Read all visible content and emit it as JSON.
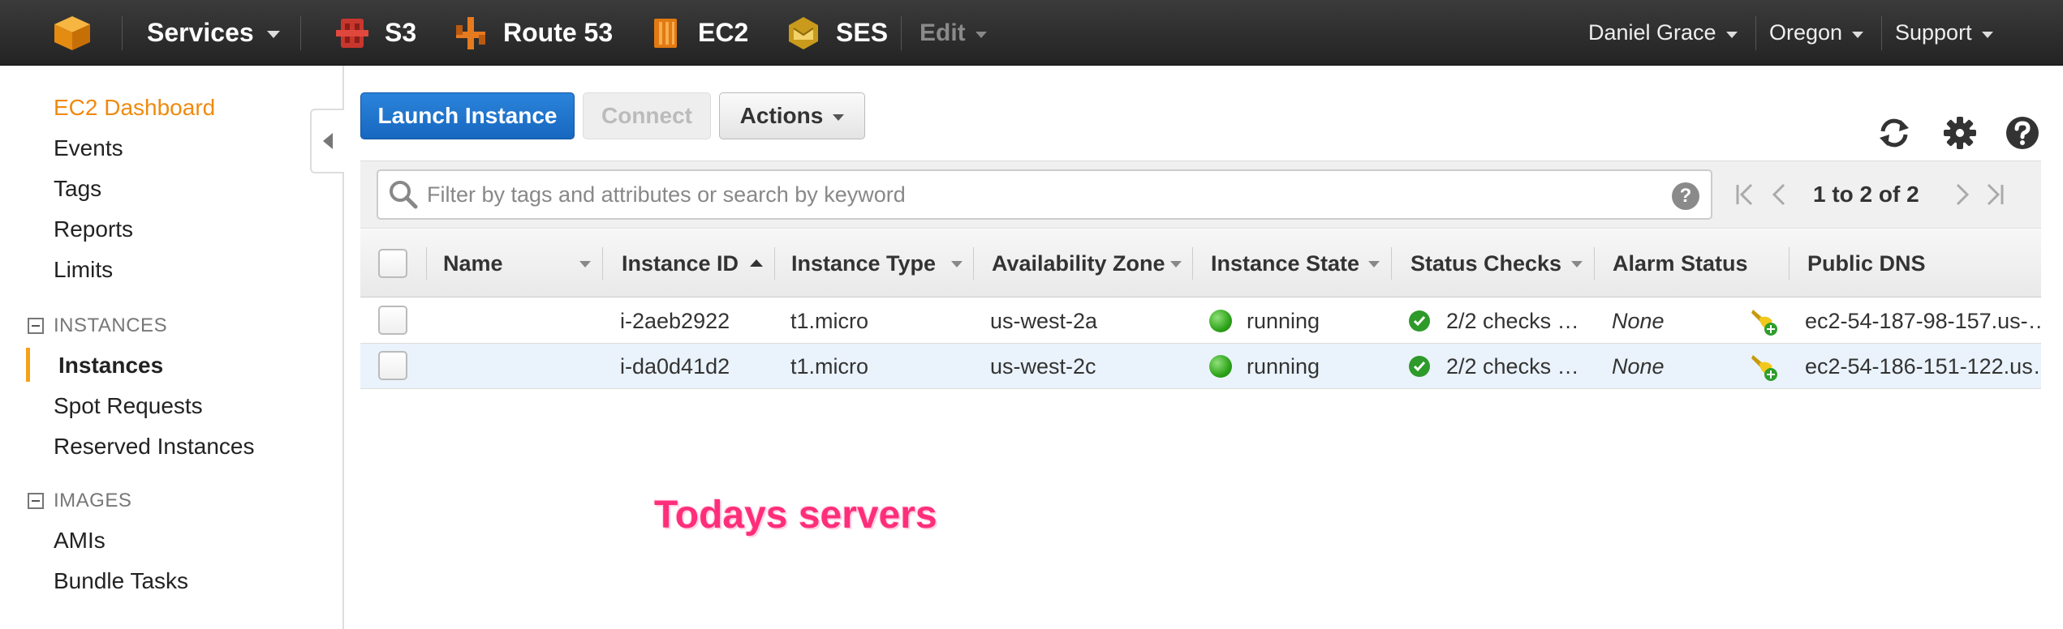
{
  "topnav": {
    "services_label": "Services",
    "shortcuts": [
      {
        "label": "S3",
        "icon": "s3-icon"
      },
      {
        "label": "Route 53",
        "icon": "route53-icon"
      },
      {
        "label": "EC2",
        "icon": "ec2-icon"
      },
      {
        "label": "SES",
        "icon": "ses-icon"
      }
    ],
    "edit_label": "Edit",
    "user_label": "Daniel Grace",
    "region_label": "Oregon",
    "support_label": "Support",
    "brand_color": "#f7a11a"
  },
  "sidebar": {
    "dashboard": "EC2 Dashboard",
    "top_links": [
      "Events",
      "Tags",
      "Reports",
      "Limits"
    ],
    "instances_section": "INSTANCES",
    "instances_links": [
      "Instances",
      "Spot Requests",
      "Reserved Instances"
    ],
    "images_section": "IMAGES",
    "images_links": [
      "AMIs",
      "Bundle Tasks"
    ]
  },
  "toolbar": {
    "launch_label": "Launch Instance",
    "connect_label": "Connect",
    "actions_label": "Actions"
  },
  "filter": {
    "placeholder": "Filter by tags and attributes or search by keyword",
    "help": "?",
    "pagination": "1 to 2 of 2"
  },
  "table": {
    "columns": [
      "Name",
      "Instance ID",
      "Instance Type",
      "Availability Zone",
      "Instance State",
      "Status Checks",
      "Alarm Status",
      "Public DNS"
    ],
    "rows": [
      {
        "name": "",
        "instance_id": "i-2aeb2922",
        "instance_type": "t1.micro",
        "zone": "us-west-2a",
        "state": "running",
        "status_checks": "2/2 checks …",
        "alarm": "None",
        "dns": "ec2-54-187-98-157.us-…"
      },
      {
        "name": "",
        "instance_id": "i-da0d41d2",
        "instance_type": "t1.micro",
        "zone": "us-west-2c",
        "state": "running",
        "status_checks": "2/2 checks …",
        "alarm": "None",
        "dns": "ec2-54-186-151-122.us…"
      }
    ]
  },
  "annotation": "Todays servers"
}
